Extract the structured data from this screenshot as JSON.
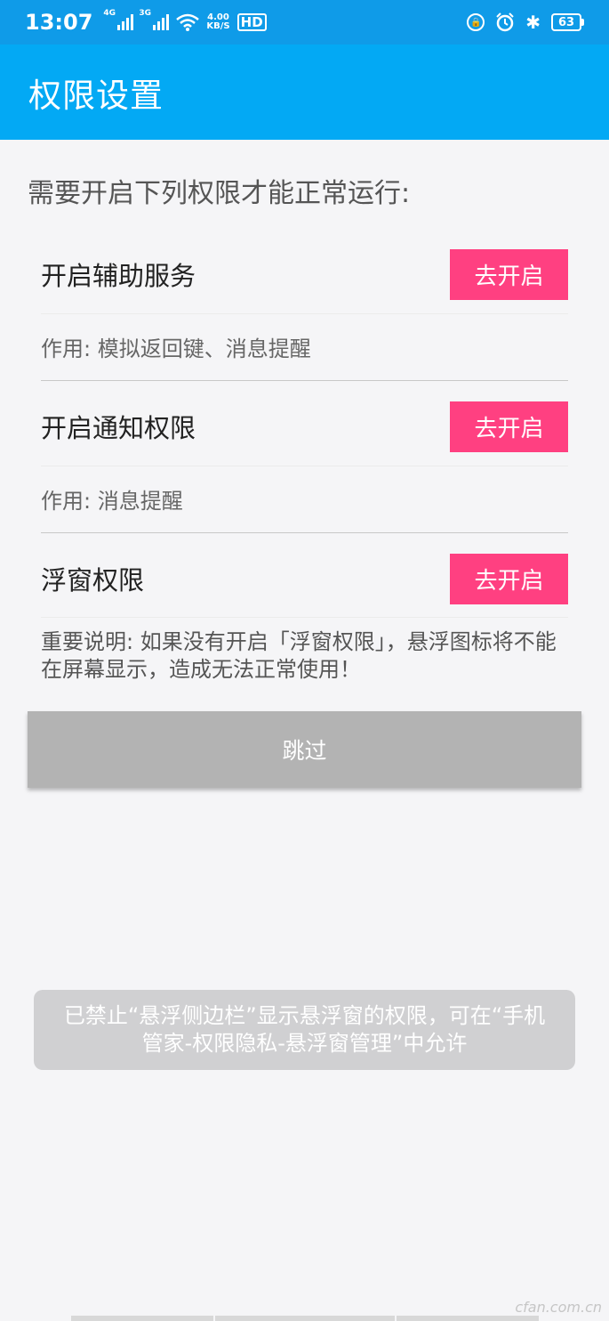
{
  "status_bar": {
    "time": "13:07",
    "signal1_label": "4G",
    "signal2_label": "3G",
    "speed_value": "4.00",
    "speed_unit": "KB/S",
    "hd_label": "HD",
    "battery": "63",
    "icons": [
      "wifi-icon",
      "lock-rotation-icon",
      "alarm-icon",
      "bluetooth-icon",
      "battery-icon"
    ]
  },
  "app_bar": {
    "title": "权限设置"
  },
  "intro": "需要开启下列权限才能正常运行:",
  "permissions": [
    {
      "title": "开启辅助服务",
      "button": "去开启",
      "desc": "作用: 模拟返回键、消息提醒"
    },
    {
      "title": "开启通知权限",
      "button": "去开启",
      "desc": "作用: 消息提醒"
    },
    {
      "title": "浮窗权限",
      "button": "去开启",
      "desc": "重要说明: 如果没有开启「浮窗权限」，悬浮图标将不能在屏幕显示，造成无法正常使用！"
    }
  ],
  "skip_button": "跳过",
  "toast": "已禁止“悬浮侧边栏”显示悬浮窗的权限，可在“手机管家-权限隐私-悬浮窗管理”中允许",
  "watermark": "cfan.com.cn",
  "colors": {
    "status_bar": "#0f9be8",
    "app_bar": "#03a9f4",
    "accent_button": "#ff4081",
    "skip_button": "#b3b3b3",
    "background": "#f5f5f7"
  }
}
